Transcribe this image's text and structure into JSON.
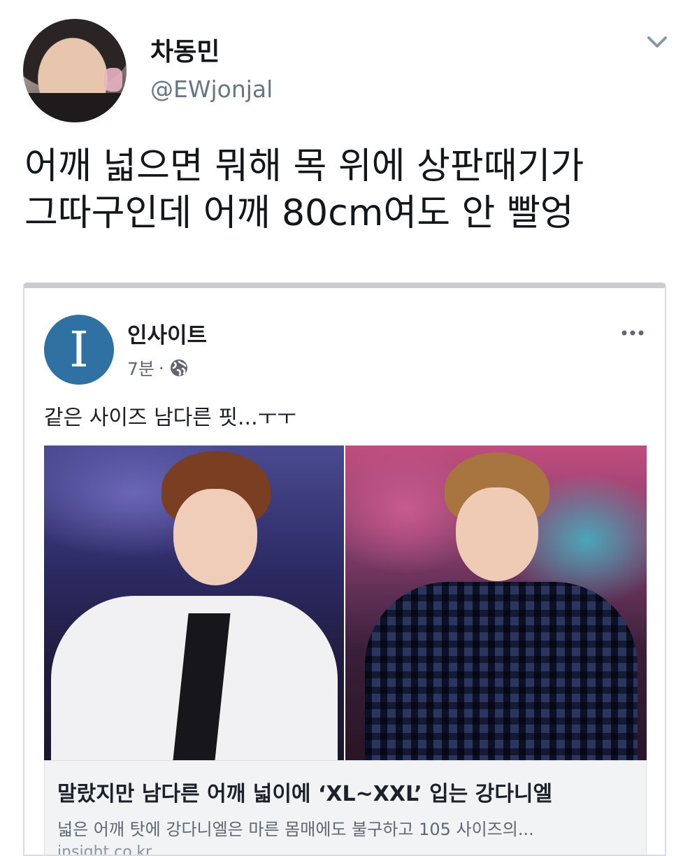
{
  "tweet": {
    "display_name": "차동민",
    "handle": "@EWjonjal",
    "text": "어깨 넓으면 뭐해 목 위에 상판때기가\n그따구인데 어깨 80cm여도 안 빨엉"
  },
  "embedded_post": {
    "page_name": "인사이트",
    "logo_letter": "I",
    "time": "7분",
    "separator": "·",
    "text": "같은 사이즈 남다른 핏...ㅜㅜ",
    "link": {
      "title": "말랐지만 남다른 어깨 넓이에 ‘XL~XXL’ 입는 강다니엘",
      "description": "넓은 어깨 탓에 강다니엘은 마른 몸매에도 불구하고 105 사이즈의...",
      "domain": "insight.co.kr"
    }
  },
  "colors": {
    "handle": "#657786",
    "logo_bg": "#2f71a3",
    "link_bg": "#f2f3f5"
  },
  "icons": {
    "chevron": "chevron-down-icon",
    "privacy": "globe-icon",
    "menu": "more-options-icon"
  }
}
